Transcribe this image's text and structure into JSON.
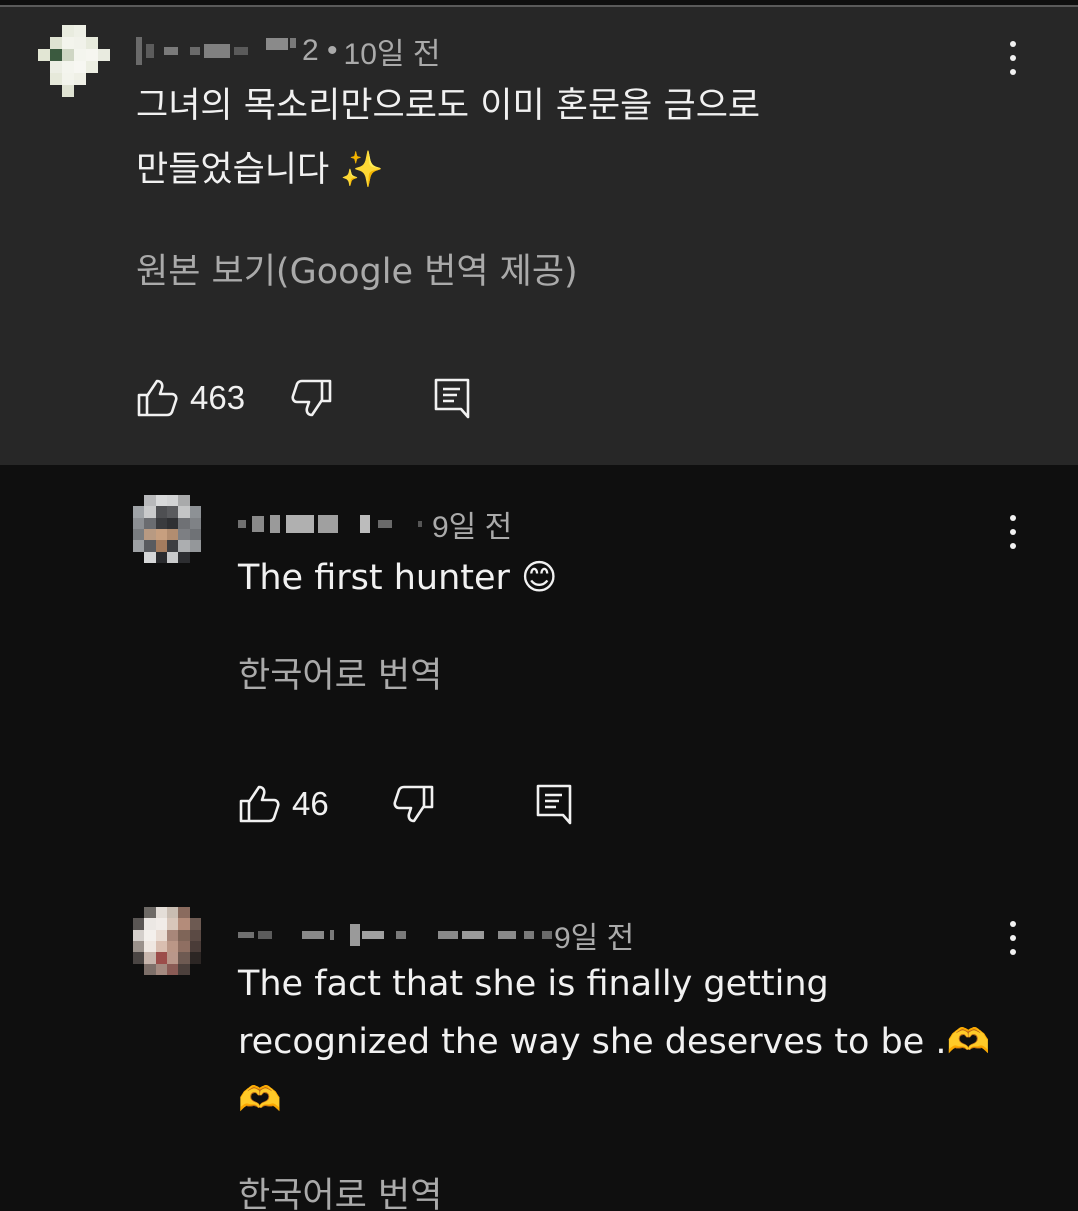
{
  "comments": [
    {
      "time": "10일 전",
      "name_tail": "2 •",
      "text_line1": "그녀의 목소리만으로도 이미 혼문을 금으로",
      "text_line2": "만들었습니다 ✨",
      "translate_label": "원본 보기(Google 번역 제공)",
      "likes": "463"
    },
    {
      "time": "9일 전",
      "text_line1": "The first hunter 😊",
      "translate_label": "한국어로 번역",
      "likes": "46"
    },
    {
      "time": "9일 전",
      "text_line1": "The fact that she is finally getting",
      "text_line2": "recognized the way she deserves to be .🫶",
      "text_line3": "🫶",
      "translate_label": "한국어로 번역"
    }
  ],
  "icons": {
    "like": "thumb-up-icon",
    "dislike": "thumb-down-icon",
    "reply": "reply-comment-icon",
    "more": "more-vert-icon"
  },
  "colors": {
    "main_comment_bg": "#272727",
    "page_bg": "#0f0f0f",
    "text_primary": "#f1f1f1",
    "text_secondary": "#aaaaaa"
  }
}
